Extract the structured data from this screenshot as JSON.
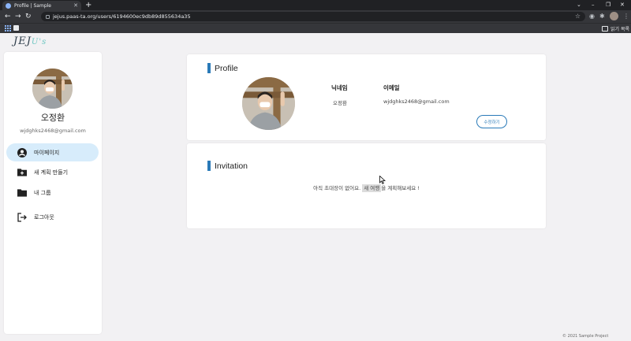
{
  "browser": {
    "tab_title": "Profile | Sample",
    "tab_close": "✕",
    "new_tab": "+",
    "window_controls": [
      "⌄",
      "–",
      "❐",
      "✕"
    ],
    "nav": [
      "←",
      "→",
      "↻"
    ],
    "url": "jejus.paas-ta.org/users/6194600ec9db89d855634a35",
    "star": "☆",
    "toolbar_icons": [
      "◉",
      "✱"
    ],
    "more": "⋮",
    "reading_list": "읽기 목록"
  },
  "logo": {
    "main": "JEJ",
    "accent": "U's"
  },
  "sidebar": {
    "name": "오정환",
    "email": "wjdghks2468@gmail.com",
    "menu": [
      {
        "label": "마이페이지",
        "icon": "account-circle-icon",
        "active": true
      },
      {
        "label": "새 계획 만들기",
        "icon": "create-folder-icon",
        "active": false
      },
      {
        "label": "내 그룹",
        "icon": "folder-icon",
        "active": false
      },
      {
        "label": "로그아웃",
        "icon": "logout-icon",
        "active": false
      }
    ]
  },
  "profile": {
    "title": "Profile",
    "nickname_header": "닉네임",
    "email_header": "이메일",
    "nickname": "오정환",
    "email": "wjdghks2468@gmail.com",
    "edit_button": "수정하기"
  },
  "invitation": {
    "title": "Invitation",
    "message_before": "아직 초대장이 없어요.",
    "message_link": "새 여행",
    "message_after": "을 계획해보세요 !"
  },
  "footer": "© 2021 Sample Project",
  "colors": {
    "accent_blue": "#2a7ab8",
    "active_menu_bg": "#d7ecfb",
    "page_bg": "#f2f1f3",
    "logo_accent": "#6fc7c2"
  }
}
